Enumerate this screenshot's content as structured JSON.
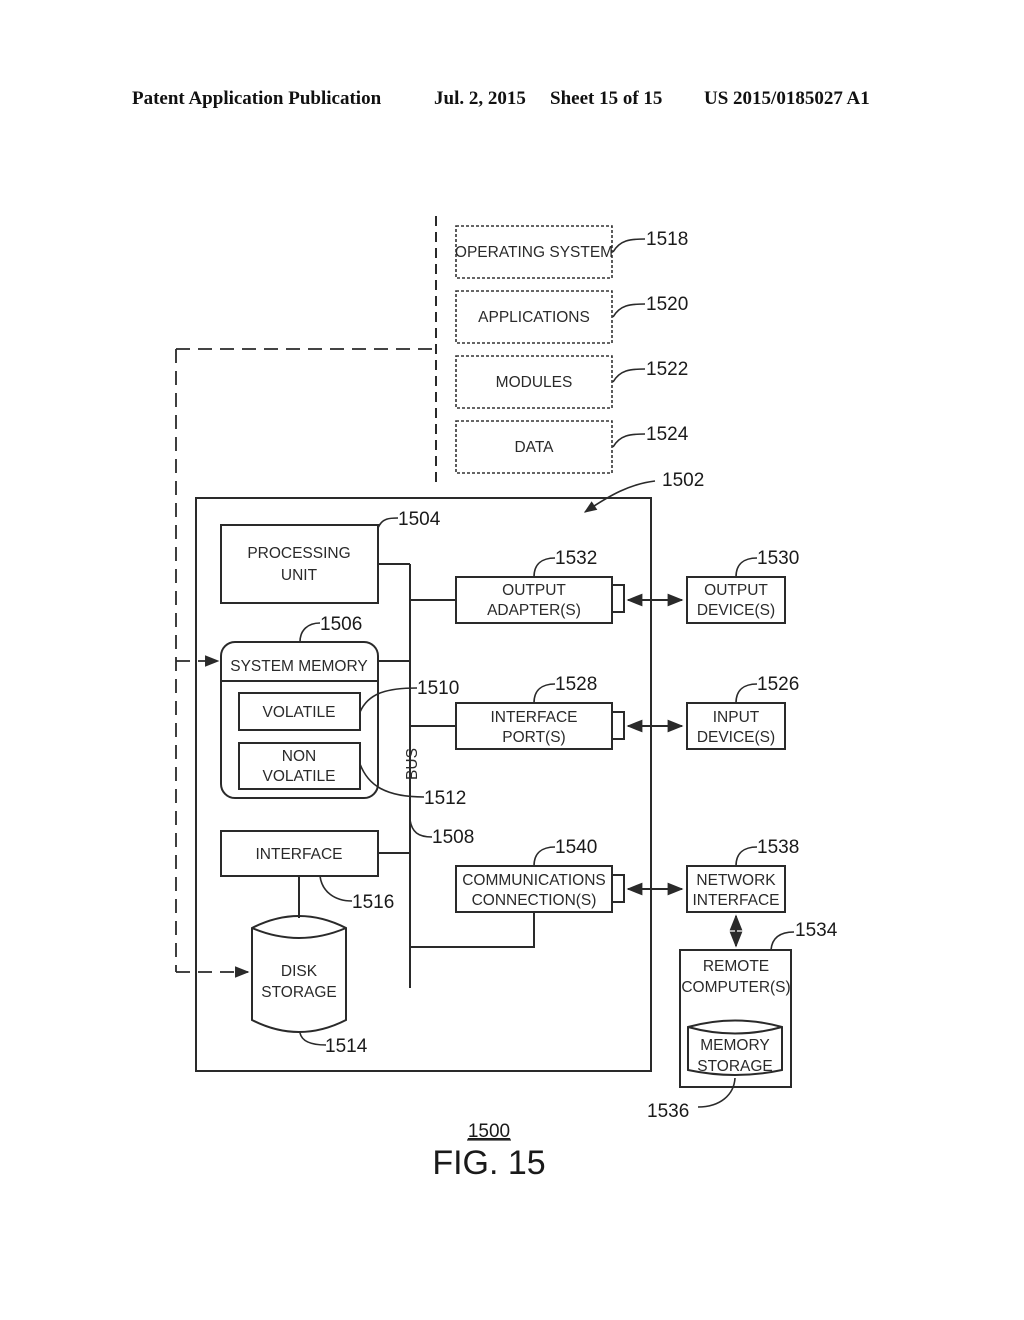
{
  "header": {
    "publication": "Patent Application Publication",
    "date": "Jul. 2, 2015",
    "sheet": "Sheet 15 of 15",
    "number": "US 2015/0185027 A1"
  },
  "software": [
    {
      "label": "OPERATING SYSTEM",
      "ref": "1518"
    },
    {
      "label": "APPLICATIONS",
      "ref": "1520"
    },
    {
      "label": "MODULES",
      "ref": "1522"
    },
    {
      "label": "DATA",
      "ref": "1524"
    }
  ],
  "computer": {
    "ref": "1502",
    "processing_unit": {
      "line1": "PROCESSING",
      "line2": "UNIT",
      "ref": "1504"
    },
    "system_memory": {
      "label": "SYSTEM MEMORY",
      "ref": "1506"
    },
    "volatile": {
      "label": "VOLATILE",
      "ref": "1510"
    },
    "non_volatile": {
      "line1": "NON",
      "line2": "VOLATILE",
      "ref": "1512"
    },
    "bus": {
      "label": "BUS",
      "ref": "1508"
    },
    "interface": {
      "label": "INTERFACE",
      "ref": "1516"
    },
    "disk_storage": {
      "line1": "DISK",
      "line2": "STORAGE",
      "ref": "1514"
    },
    "output_adapter": {
      "line1": "OUTPUT",
      "line2": "ADAPTER(S)",
      "ref": "1532"
    },
    "interface_port": {
      "line1": "INTERFACE",
      "line2": "PORT(S)",
      "ref": "1528"
    },
    "comm_connection": {
      "line1": "COMMUNICATIONS",
      "line2": "CONNECTION(S)",
      "ref": "1540"
    }
  },
  "external": {
    "output_device": {
      "line1": "OUTPUT",
      "line2": "DEVICE(S)",
      "ref": "1530"
    },
    "input_device": {
      "line1": "INPUT",
      "line2": "DEVICE(S)",
      "ref": "1526"
    },
    "network_interface": {
      "line1": "NETWORK",
      "line2": "INTERFACE",
      "ref": "1538"
    },
    "remote_computer": {
      "line1": "REMOTE",
      "line2": "COMPUTER(S)",
      "ref": "1534"
    },
    "memory_storage": {
      "line1": "MEMORY",
      "line2": "STORAGE",
      "ref": "1536"
    }
  },
  "figure": {
    "number": "1500",
    "title": "FIG. 15"
  }
}
